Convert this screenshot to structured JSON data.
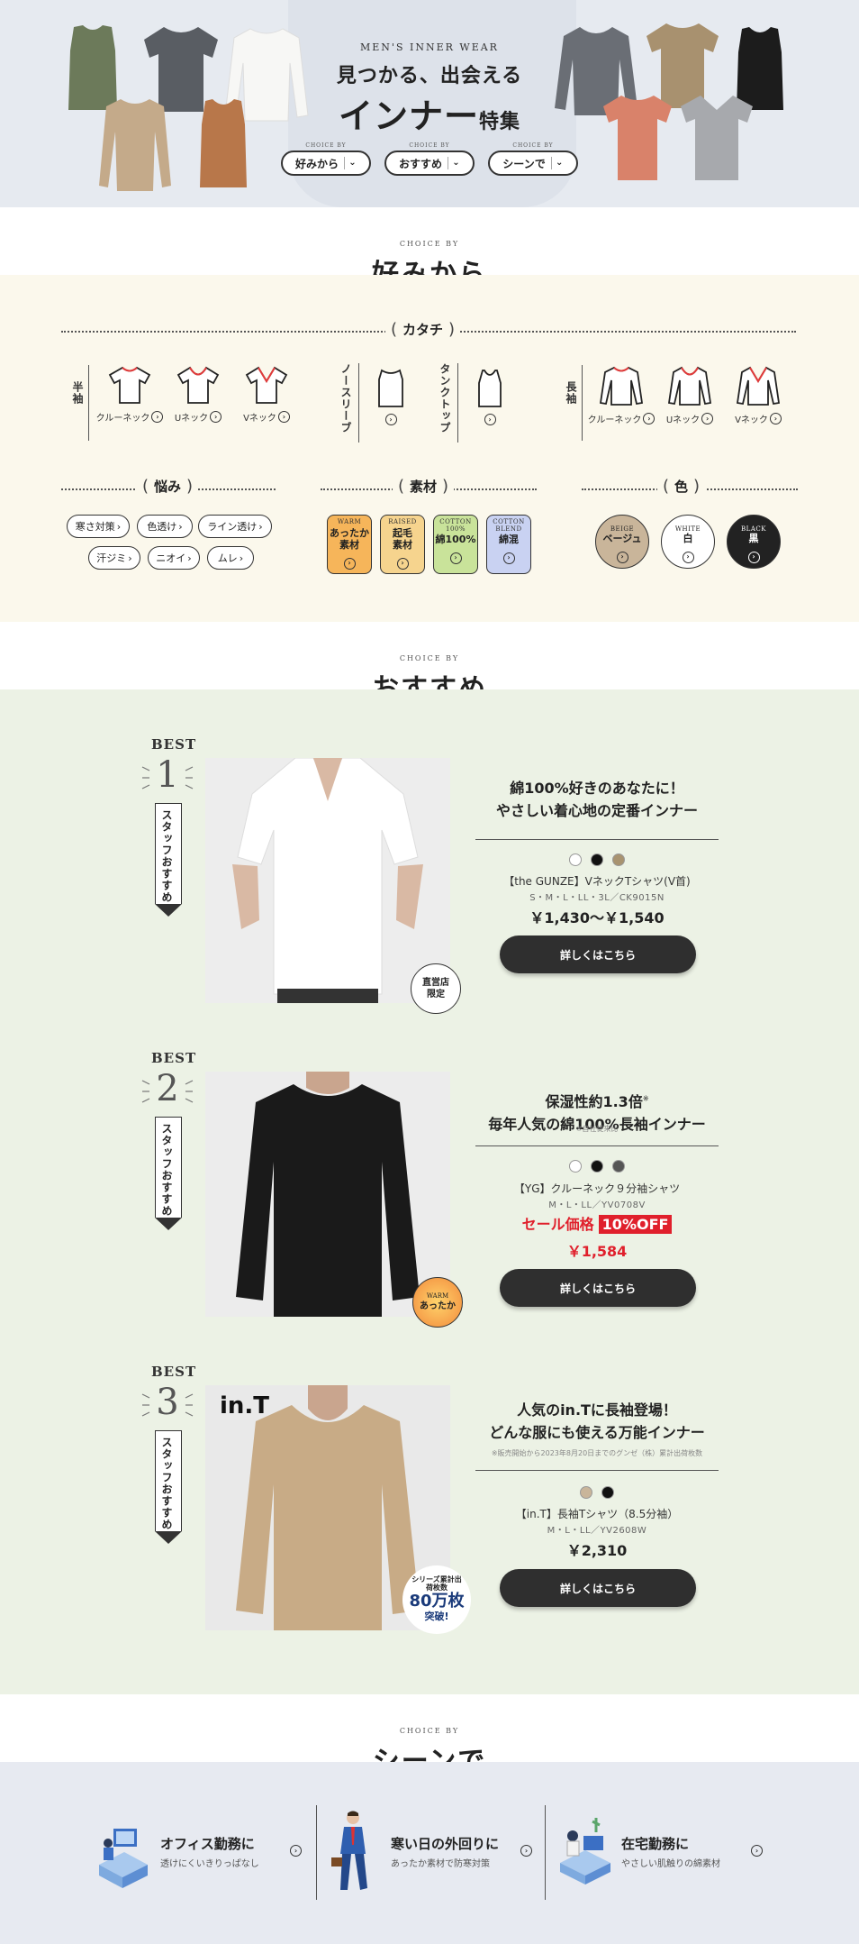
{
  "hero": {
    "eyebrow": "MEN'S INNER WEAR",
    "title_line1": "見つかる、出会える",
    "title_main": "インナー",
    "title_suffix": "特集",
    "choice_by": "CHOICE BY",
    "buttons": [
      "好みから",
      "おすすめ",
      "シーンで"
    ]
  },
  "preference": {
    "choice_by": "CHOICE BY",
    "title": "好みから",
    "shape_label": "カタチ",
    "short_sleeve_label": "半袖",
    "long_sleeve_label": "長袖",
    "sleeveless_label": "ノースリーブ",
    "tanktop_label": "タンクトップ",
    "short_items": [
      "クルーネック",
      "Uネック",
      "Vネック"
    ],
    "long_items": [
      "クルーネック",
      "Uネック",
      "Vネック"
    ],
    "concerns_label": "悩み",
    "concerns": [
      "寒さ対策",
      "色透け",
      "ライン透け",
      "汗ジミ",
      "ニオイ",
      "ムレ"
    ],
    "material_label": "素材",
    "materials": [
      {
        "en": "WARM",
        "jp1": "あったか",
        "jp2": "素材",
        "color": "#f6b55a"
      },
      {
        "en": "RAISED",
        "jp1": "起毛",
        "jp2": "素材",
        "color": "#f6d48e"
      },
      {
        "en": "COTTON 100%",
        "jp1": "綿100%",
        "jp2": "",
        "color": "#c9e39a"
      },
      {
        "en": "COTTON BLEND",
        "jp1": "綿混",
        "jp2": "",
        "color": "#c9d2f2"
      }
    ],
    "color_label": "色",
    "colors": [
      {
        "en": "BEIGE",
        "jp": "ベージュ",
        "bg": "#c9b59a",
        "fg": "#222"
      },
      {
        "en": "WHITE",
        "jp": "白",
        "bg": "#ffffff",
        "fg": "#222"
      },
      {
        "en": "BLACK",
        "jp": "黒",
        "bg": "#222222",
        "fg": "#ffffff"
      }
    ]
  },
  "recommend": {
    "choice_by": "CHOICE BY",
    "title": "おすすめ",
    "best_label": "BEST",
    "staff_label": "スタッフおすすめ",
    "button_label": "詳しくはこちら",
    "items": [
      {
        "rank": "1",
        "headline1": "綿100%好きのあなたに！",
        "headline2": "やさしい着心地の定番インナー",
        "note": "",
        "swatches": [
          "#ffffff",
          "#111111",
          "#a89370"
        ],
        "name": "【the GUNZE】VネックTシャツ(V首)",
        "sizes": "S・M・L・LL・3L／CK9015N",
        "price": "￥1,430〜￥1,540",
        "sale_label": "",
        "sale_off": "",
        "badge": "直営店限定"
      },
      {
        "rank": "2",
        "headline1": "保湿性約1.3倍",
        "headline1_sup": "※",
        "headline2": "毎年人気の綿100%長袖インナー",
        "note": "※自社従来比",
        "swatches": [
          "#ffffff",
          "#111111",
          "#555555"
        ],
        "name": "【YG】クルーネック９分袖シャツ",
        "sizes": "M・L・LL／YV0708V",
        "price": "￥1,584",
        "sale_label": "セール価格",
        "sale_off": "10%OFF",
        "badge_en": "WARM",
        "badge": "あったか"
      },
      {
        "rank": "3",
        "headline1": "人気のin.Tに長袖登場！",
        "headline2": "どんな服にも使える万能インナー",
        "note": "※販売開始から2023年8月20日までのグンゼ（株）累計出荷枚数",
        "swatches": [
          "#c9b59a",
          "#111111"
        ],
        "name": "【in.T】長袖Tシャツ（8.5分袖）",
        "sizes": "M・L・LL／YV2608W",
        "price": "￥2,310",
        "sale_label": "",
        "sale_off": "",
        "logo": "in.T",
        "badge_top": "シリーズ累計出荷枚数",
        "badge_big": "80万枚",
        "badge_bottom": "突破!"
      }
    ]
  },
  "scene": {
    "choice_by": "CHOICE BY",
    "title": "シーンで",
    "items": [
      {
        "title": "オフィス勤務に",
        "sub": "透けにくいきりっぱなし"
      },
      {
        "title": "寒い日の外回りに",
        "sub": "あったか素材で防寒対策"
      },
      {
        "title": "在宅勤務に",
        "sub": "やさしい肌触りの綿素材"
      }
    ]
  }
}
